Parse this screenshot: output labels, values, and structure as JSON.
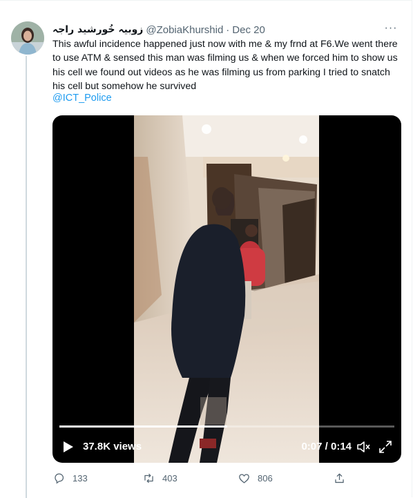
{
  "tweet": {
    "display_name": "زوبیہ خُورشید راجہ",
    "handle": "@ZobiaKhurshid",
    "separator": "·",
    "date": "Dec 20",
    "more_label": "···",
    "text": "This awful incidence happened just now with me & my frnd at F6.We went there to use ATM  & sensed this man was filming us & when we forced him to show us his cell we found out videos as he was filming us from parking I tried to snatch his cell but somehow he survived",
    "mention": "@ICT_Police"
  },
  "video": {
    "views": "37.8K views",
    "time": "0:07 / 0:14",
    "progress": 0.5,
    "icons": [
      "play-icon",
      "volume-icon",
      "fullscreen-icon"
    ]
  },
  "actions": {
    "replies": "133",
    "retweets": "403",
    "likes": "806"
  },
  "colors": {
    "accent": "#1d9bf0",
    "secondary_text": "#536471",
    "thread_line": "#cfd9de"
  }
}
